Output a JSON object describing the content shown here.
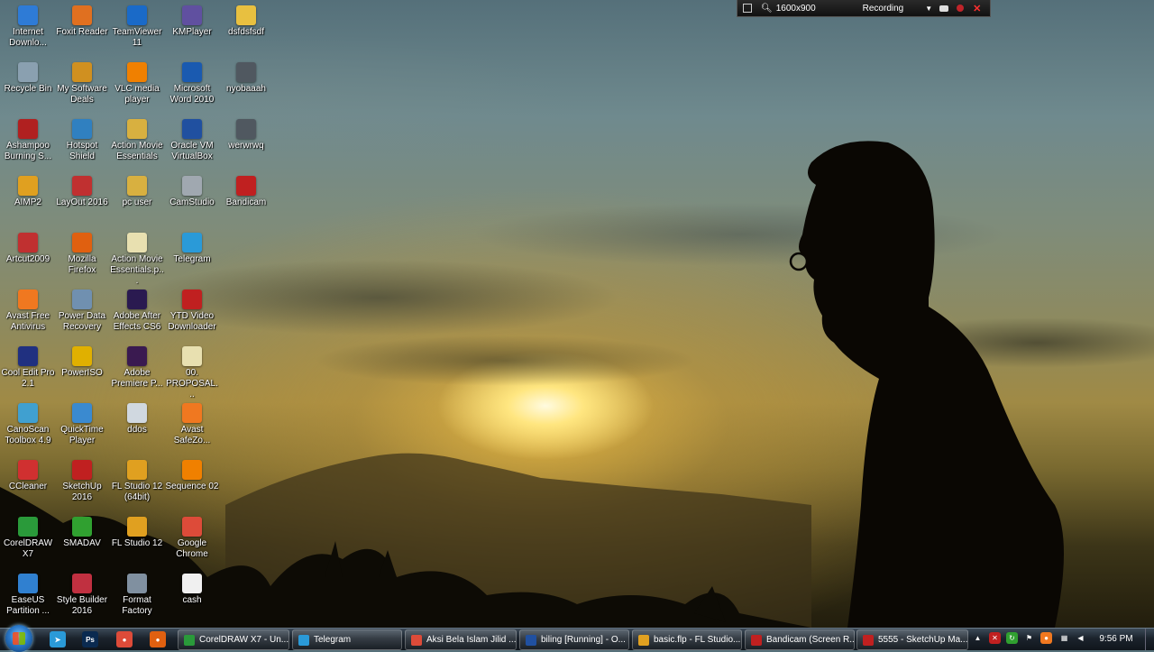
{
  "recorder": {
    "resolution": "1600x900",
    "status": "Recording"
  },
  "desktop_icons": [
    {
      "label": "Internet Downlo...",
      "icon": "internet-download-manager-icon",
      "color": "#2e7bd6"
    },
    {
      "label": "Recycle Bin",
      "icon": "recycle-bin-icon",
      "color": "#8aa0b0"
    },
    {
      "label": "Ashampoo Burning S...",
      "icon": "ashampoo-icon",
      "color": "#b02020"
    },
    {
      "label": "AIMP2",
      "icon": "aimp-icon",
      "color": "#e0a020"
    },
    {
      "label": "Artcut2009",
      "icon": "artcut-icon",
      "color": "#c03030"
    },
    {
      "label": "Avast Free Antivirus",
      "icon": "avast-icon",
      "color": "#f07820"
    },
    {
      "label": "Cool Edit Pro 2.1",
      "icon": "cool-edit-icon",
      "color": "#203080"
    },
    {
      "label": "CanoScan Toolbox 4.9",
      "icon": "canoscan-icon",
      "color": "#40a0d0"
    },
    {
      "label": "CCleaner",
      "icon": "ccleaner-icon",
      "color": "#d03030"
    },
    {
      "label": "CorelDRAW X7",
      "icon": "coreldraw-icon",
      "color": "#2a9a3a"
    },
    {
      "label": "EaseUS Partition ...",
      "icon": "easeus-icon",
      "color": "#3080d0"
    },
    {
      "label": "Foxit Reader",
      "icon": "foxit-icon",
      "color": "#e07020"
    },
    {
      "label": "My Software Deals",
      "icon": "shopping-cart-icon",
      "color": "#d09020"
    },
    {
      "label": "Hotspot Shield",
      "icon": "hotspot-shield-icon",
      "color": "#3080c0"
    },
    {
      "label": "LayOut 2016",
      "icon": "layout-icon",
      "color": "#c03030"
    },
    {
      "label": "Mozilla Firefox",
      "icon": "firefox-icon",
      "color": "#e06010"
    },
    {
      "label": "Power Data Recovery",
      "icon": "power-data-recovery-icon",
      "color": "#7090b0"
    },
    {
      "label": "PowerISO",
      "icon": "poweriso-icon",
      "color": "#e0b000"
    },
    {
      "label": "QuickTime Player",
      "icon": "quicktime-icon",
      "color": "#3a8ad0"
    },
    {
      "label": "SketchUp 2016",
      "icon": "sketchup-icon",
      "color": "#c02020"
    },
    {
      "label": "SMADAV",
      "icon": "smadav-icon",
      "color": "#30a030"
    },
    {
      "label": "Style Builder 2016",
      "icon": "style-builder-icon",
      "color": "#c03040"
    },
    {
      "label": "TeamViewer 11",
      "icon": "teamviewer-icon",
      "color": "#1a6ac8"
    },
    {
      "label": "VLC media player",
      "icon": "vlc-icon",
      "color": "#f08000"
    },
    {
      "label": "Action Movie Essentials",
      "icon": "folder-icon",
      "color": "#d8b040"
    },
    {
      "label": "pc user",
      "icon": "folder-icon",
      "color": "#d8b040"
    },
    {
      "label": "Action Movie Essentials.p...",
      "icon": "document-icon",
      "color": "#e8e0b0"
    },
    {
      "label": "Adobe After Effects CS6",
      "icon": "after-effects-icon",
      "color": "#2a1a50"
    },
    {
      "label": "Adobe Premiere P...",
      "icon": "premiere-icon",
      "color": "#3a1a50"
    },
    {
      "label": "ddos",
      "icon": "document-icon",
      "color": "#d0d8e0"
    },
    {
      "label": "FL Studio 12 (64bit)",
      "icon": "fl-studio-icon",
      "color": "#e0a020"
    },
    {
      "label": "FL Studio 12",
      "icon": "fl-studio-icon",
      "color": "#e0a020"
    },
    {
      "label": "Format Factory",
      "icon": "format-factory-icon",
      "color": "#8090a0"
    },
    {
      "label": "KMPlayer",
      "icon": "kmplayer-icon",
      "color": "#6050a0"
    },
    {
      "label": "Microsoft Word 2010",
      "icon": "word-icon",
      "color": "#1a5ab0"
    },
    {
      "label": "Oracle VM VirtualBox",
      "icon": "virtualbox-icon",
      "color": "#2050a0"
    },
    {
      "label": "CamStudio",
      "icon": "camstudio-icon",
      "color": "#a0a8b0"
    },
    {
      "label": "Telegram",
      "icon": "telegram-icon",
      "color": "#2a9ad8"
    },
    {
      "label": "YTD Video Downloader",
      "icon": "ytd-icon",
      "color": "#c02020"
    },
    {
      "label": "00. PROPOSAL...",
      "icon": "document-icon",
      "color": "#e8e0b0"
    },
    {
      "label": "Avast SafeZo...",
      "icon": "avast-safezone-icon",
      "color": "#f07820"
    },
    {
      "label": "Sequence 02",
      "icon": "vlc-icon",
      "color": "#f08000"
    },
    {
      "label": "Google Chrome",
      "icon": "chrome-icon",
      "color": "#dd4b39"
    },
    {
      "label": "cash",
      "icon": "document-icon",
      "color": "#f0f0f0"
    },
    {
      "label": "dsfdsfsdf",
      "icon": "folder-icon",
      "color": "#e8c040"
    },
    {
      "label": "nyobaaah",
      "icon": "drive-icon",
      "color": "#505860"
    },
    {
      "label": "werwrwq",
      "icon": "drive-icon",
      "color": "#505860"
    },
    {
      "label": "Bandicam",
      "icon": "bandicam-icon",
      "color": "#c02020"
    }
  ],
  "taskbar": {
    "pinned": [
      {
        "icon": "telegram-icon",
        "color": "#2a9ad8",
        "glyph": "➤"
      },
      {
        "icon": "photoshop-icon",
        "color": "#0a2a50",
        "glyph": "Ps"
      },
      {
        "icon": "chrome-icon",
        "color": "#dd4b39",
        "glyph": "●"
      },
      {
        "icon": "firefox-icon",
        "color": "#e06010",
        "glyph": "●"
      }
    ],
    "buttons": [
      {
        "label": "CorelDRAW X7 - Un...",
        "icon": "coreldraw-icon",
        "color": "#2a9a3a"
      },
      {
        "label": "Telegram",
        "icon": "telegram-icon",
        "color": "#2a9ad8"
      },
      {
        "label": "Aksi Bela Islam Jilid ...",
        "icon": "chrome-icon",
        "color": "#dd4b39"
      },
      {
        "label": "biling [Running] - O...",
        "icon": "virtualbox-icon",
        "color": "#2050a0"
      },
      {
        "label": "basic.flp - FL Studio...",
        "icon": "fl-studio-icon",
        "color": "#e0a020"
      },
      {
        "label": "Bandicam (Screen R...",
        "icon": "bandicam-icon",
        "color": "#c02020"
      },
      {
        "label": "5555 - SketchUp Ma...",
        "icon": "sketchup-icon",
        "color": "#c02020"
      }
    ],
    "tray": [
      {
        "icon": "show-hidden-icons-icon",
        "color": "transparent",
        "glyph": "▲"
      },
      {
        "icon": "security-alert-icon",
        "color": "#c02020",
        "glyph": "✕"
      },
      {
        "icon": "update-icon",
        "color": "#30a030",
        "glyph": "↻"
      },
      {
        "icon": "flag-icon",
        "color": "transparent",
        "glyph": "⚑"
      },
      {
        "icon": "avast-tray-icon",
        "color": "#f07820",
        "glyph": "●"
      },
      {
        "icon": "network-icon",
        "color": "transparent",
        "glyph": "▦"
      },
      {
        "icon": "volume-icon",
        "color": "transparent",
        "glyph": "◀"
      }
    ],
    "clock": "9:56 PM"
  }
}
